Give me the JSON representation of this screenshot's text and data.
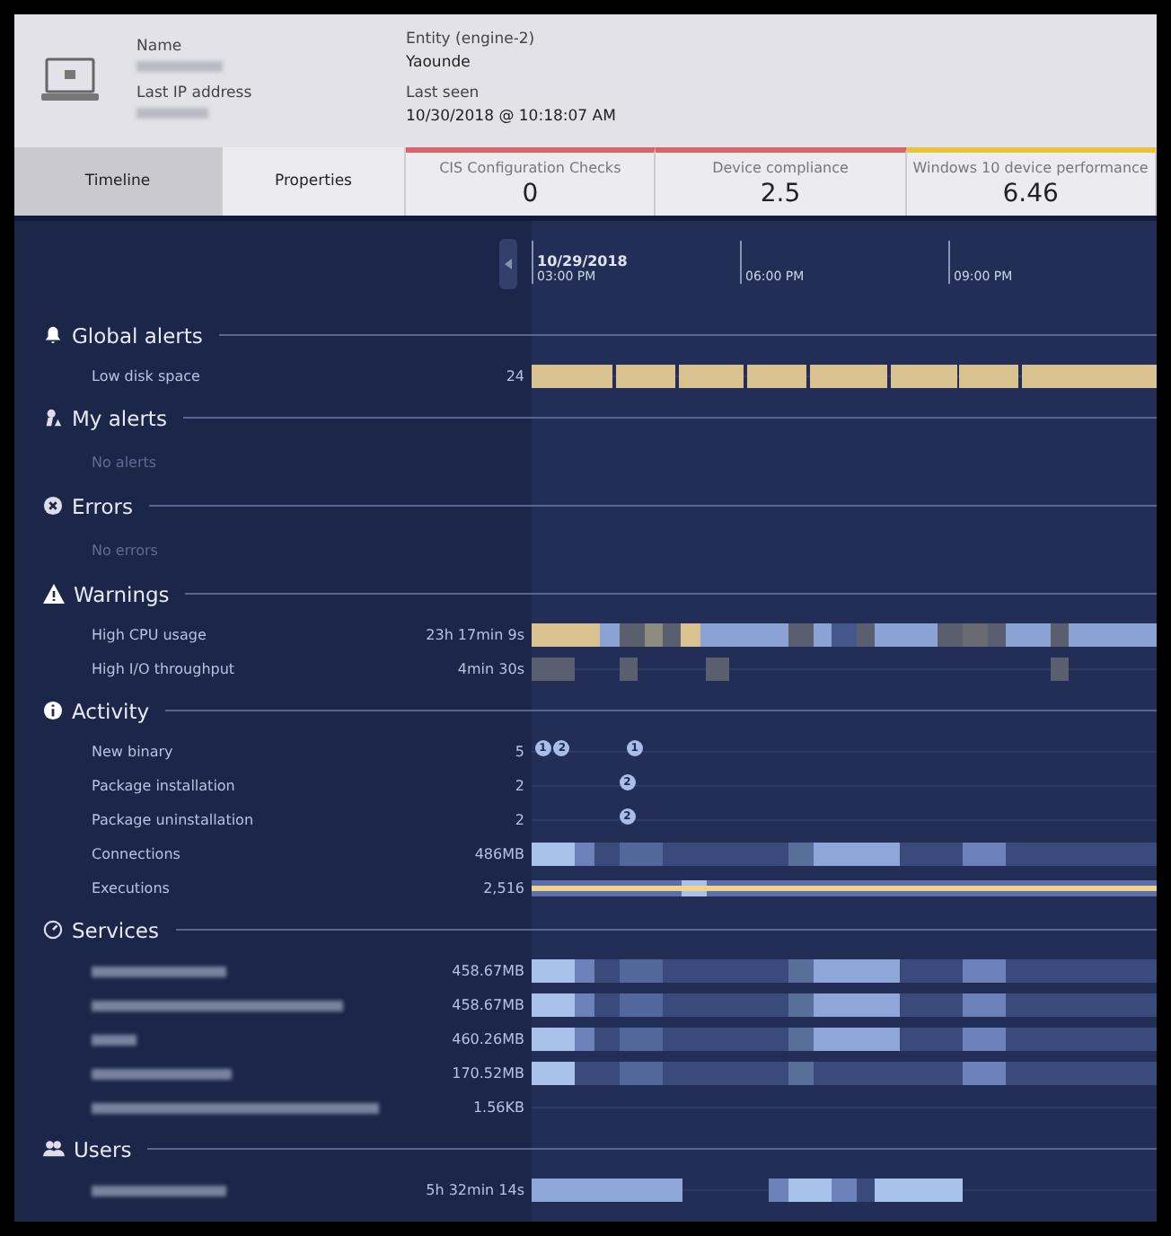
{
  "device": {
    "fields": [
      {
        "label": "Name",
        "redacted": true
      },
      {
        "label": "Last IP address",
        "redacted": true
      }
    ],
    "details": [
      {
        "label": "Entity (engine-2)",
        "value": "Yaounde"
      },
      {
        "label": "Last seen",
        "value": "10/30/2018 @ 10:18:07 AM"
      }
    ]
  },
  "tabs": [
    {
      "label": "Timeline",
      "selected": true
    },
    {
      "label": "Properties",
      "selected": false
    }
  ],
  "scores": [
    {
      "label": "CIS Configuration Checks",
      "value": "0",
      "color": "#d9646e"
    },
    {
      "label": "Device compliance",
      "value": "2.5",
      "color": "#d9646e"
    },
    {
      "label": "Windows 10 device performance",
      "value": "6.46",
      "color": "#e8c43a"
    }
  ],
  "timeline": {
    "date": "10/29/2018",
    "ticks": [
      "03:00 PM",
      "06:00 PM",
      "09:00 PM"
    ]
  },
  "sections": [
    {
      "title": "Global alerts",
      "rows": [
        {
          "name": "Low disk space",
          "value": "24",
          "kind": "alert"
        }
      ]
    },
    {
      "title": "My alerts",
      "empty": "No alerts"
    },
    {
      "title": "Errors",
      "empty": "No errors"
    },
    {
      "title": "Warnings",
      "rows": [
        {
          "name": "High CPU usage",
          "value": "23h 17min 9s",
          "kind": "cpu"
        },
        {
          "name": "High I/O throughput",
          "value": "4min 30s",
          "kind": "io"
        }
      ]
    },
    {
      "title": "Activity",
      "rows": [
        {
          "name": "New binary",
          "value": "5",
          "kind": "markers",
          "markers": [
            "1",
            "2",
            "1"
          ]
        },
        {
          "name": "Package installation",
          "value": "2",
          "kind": "markers",
          "markers": [
            "2"
          ]
        },
        {
          "name": "Package uninstallation",
          "value": "2",
          "kind": "markers",
          "markers": [
            "2"
          ]
        },
        {
          "name": "Connections",
          "value": "486MB",
          "kind": "traffic"
        },
        {
          "name": "Executions",
          "value": "2,516",
          "kind": "executions"
        }
      ]
    },
    {
      "title": "Services",
      "rows": [
        {
          "redacted": true,
          "value": "458.67MB",
          "kind": "traffic"
        },
        {
          "redacted": true,
          "value": "458.67MB",
          "kind": "traffic"
        },
        {
          "redacted": true,
          "value": "460.26MB",
          "kind": "traffic"
        },
        {
          "redacted": true,
          "value": "170.52MB",
          "kind": "traffic2"
        },
        {
          "redacted": true,
          "value": "1.56KB",
          "kind": "none"
        }
      ]
    },
    {
      "title": "Users",
      "rows": [
        {
          "redacted": true,
          "value": "5h 32min 14s",
          "kind": "users"
        }
      ]
    }
  ]
}
